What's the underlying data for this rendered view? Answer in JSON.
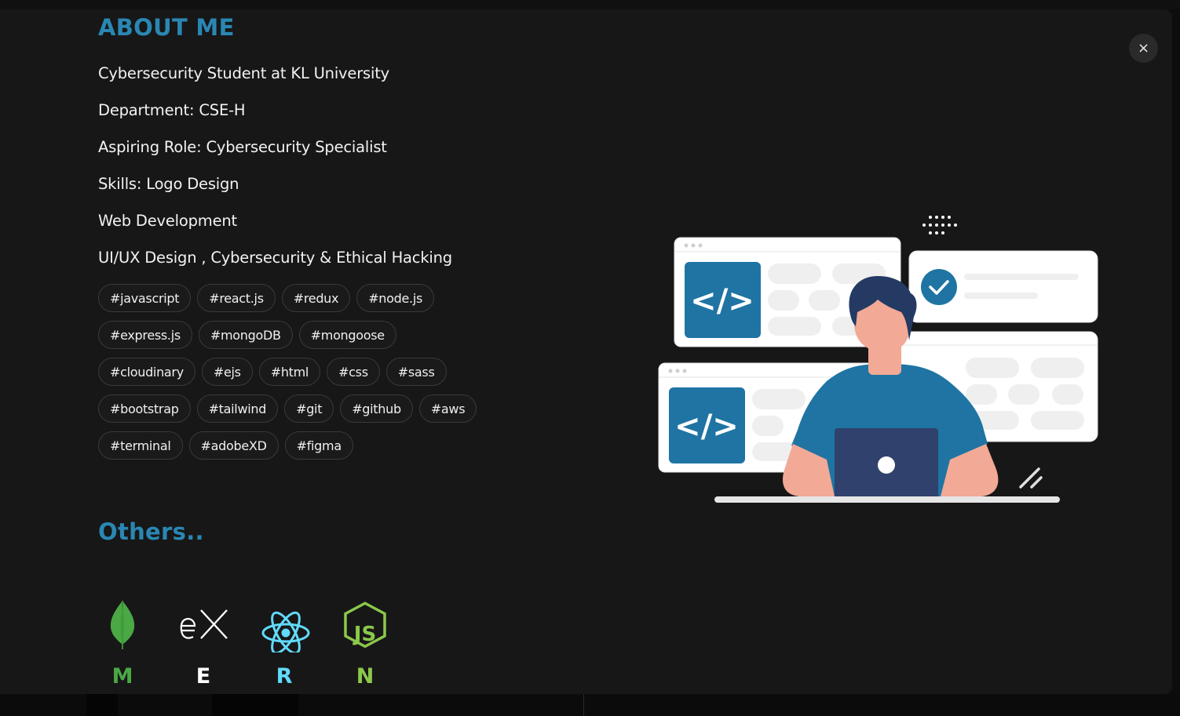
{
  "close_button": {
    "icon": "close-icon",
    "label": "×"
  },
  "about": {
    "title": "ABOUT ME",
    "lines": [
      "Cybersecurity Student at KL University",
      "Department: CSE-H",
      "Aspiring Role: Cybersecurity Specialist",
      "Skills: Logo Design",
      "Web Development",
      "UI/UX Design , Cybersecurity & Ethical Hacking"
    ]
  },
  "tags": [
    [
      "#javascript",
      "#react.js",
      "#redux",
      "#node.js"
    ],
    [
      "#express.js",
      "#mongoDB",
      "#mongoose"
    ],
    [
      "#cloudinary",
      "#ejs",
      "#html",
      "#css",
      "#sass"
    ],
    [
      "#bootstrap",
      "#tailwind",
      "#git",
      "#github",
      "#aws"
    ],
    [
      "#terminal",
      "#adobeXD",
      "#figma"
    ]
  ],
  "others": {
    "title": "Others..",
    "stack": [
      {
        "icon": "mongodb-leaf-icon",
        "letter": "M",
        "color": "#4aa845"
      },
      {
        "icon": "express-icon",
        "letter": "E",
        "color": "#ffffff"
      },
      {
        "icon": "react-atom-icon",
        "letter": "R",
        "color": "#61dafb"
      },
      {
        "icon": "nodejs-hexagon-icon",
        "letter": "N",
        "color": "#8cc84b"
      }
    ]
  },
  "colors": {
    "accent": "#2a87b3",
    "background": "#171717",
    "illustration_blue": "#1f74a3"
  }
}
